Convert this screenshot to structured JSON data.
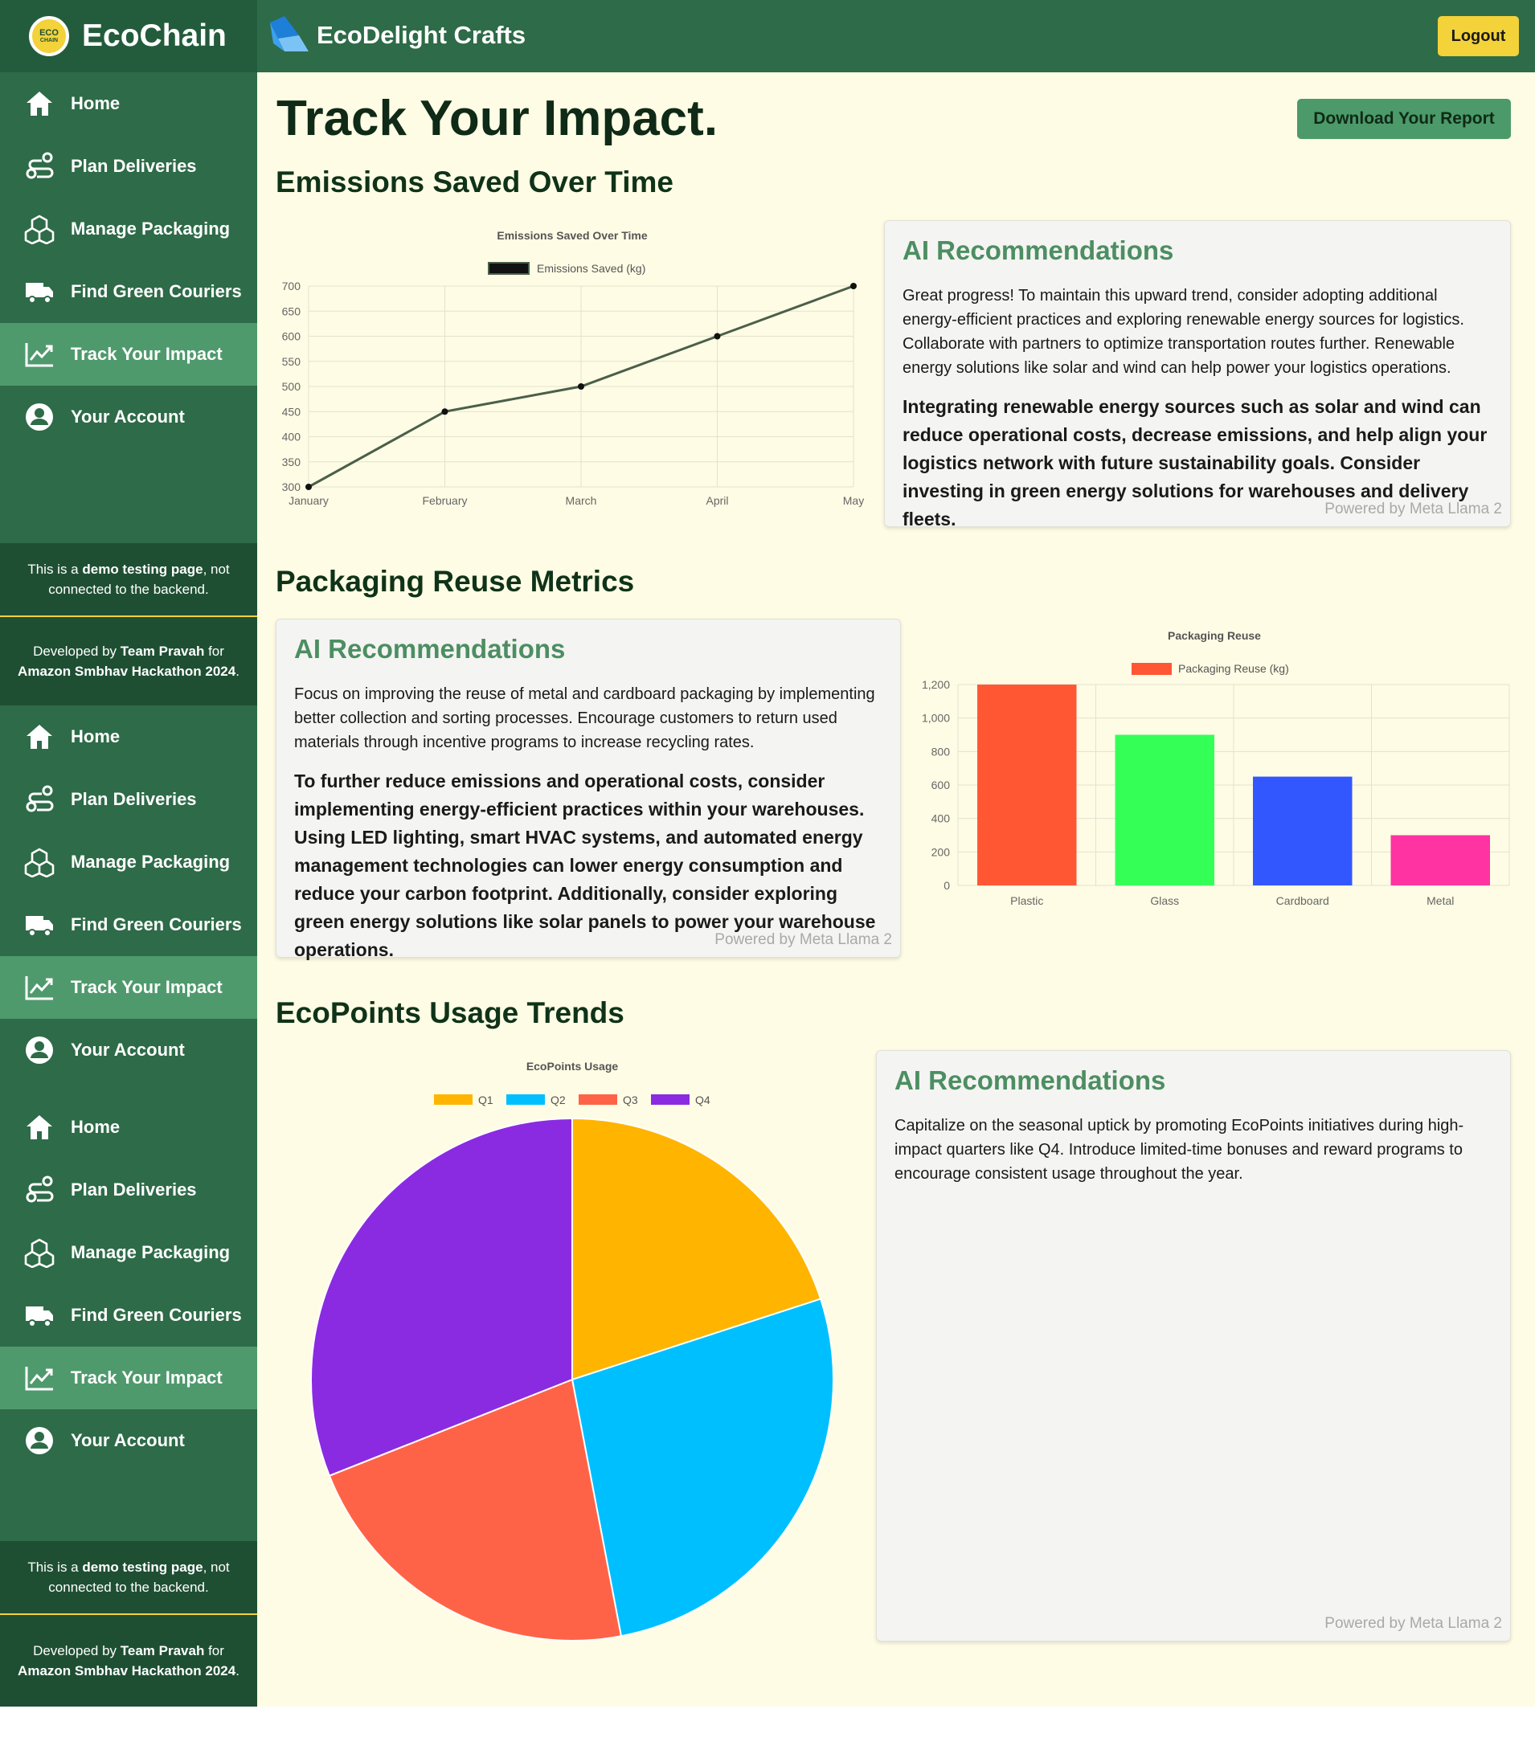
{
  "app": {
    "name": "EcoChain",
    "logo_top": "ECO",
    "logo_bottom": "CHAIN",
    "company": "EcoDelight Crafts",
    "logout": "Logout"
  },
  "nav": [
    {
      "label": "Home",
      "icon": "home-icon"
    },
    {
      "label": "Plan Deliveries",
      "icon": "route-icon"
    },
    {
      "label": "Manage Packaging",
      "icon": "boxes-icon"
    },
    {
      "label": "Find Green Couriers",
      "icon": "truck-icon"
    },
    {
      "label": "Track Your Impact",
      "icon": "chart-line-icon",
      "active": true
    },
    {
      "label": "Your Account",
      "icon": "user-circle-icon"
    }
  ],
  "sidebar_notes": {
    "demo_pre": "This is a ",
    "demo_bold": "demo testing page",
    "demo_post": ", not connected to the backend.",
    "dev_pre": "Developed by ",
    "dev_bold1": "Team Pravah",
    "dev_mid": " for ",
    "dev_bold2": "Amazon Smbhav Hackathon 2024",
    "dev_post": "."
  },
  "page": {
    "title": "Track Your Impact.",
    "download_button": "Download Your Report"
  },
  "sections": {
    "emissions": "Emissions Saved Over Time",
    "packaging": "Packaging Reuse Metrics",
    "ecopoints": "EcoPoints Usage Trends"
  },
  "ai": {
    "title": "AI Recommendations",
    "powered": "Powered by Meta Llama 2",
    "emissions_small": "Great progress! To maintain this upward trend, consider adopting additional energy-efficient practices and exploring renewable energy sources for logistics. Collaborate with partners to optimize transportation routes further. Renewable energy solutions like solar and wind can help power your logistics operations.",
    "emissions_big": "Integrating renewable energy sources such as solar and wind can reduce operational costs, decrease emissions, and help align your logistics network with future sustainability goals. Consider investing in green energy solutions for warehouses and delivery fleets.",
    "packaging_small": "Focus on improving the reuse of metal and cardboard packaging by implementing better collection and sorting processes. Encourage customers to return used materials through incentive programs to increase recycling rates.",
    "packaging_big": "To further reduce emissions and operational costs, consider implementing energy-efficient practices within your warehouses. Using LED lighting, smart HVAC systems, and automated energy management technologies can lower energy consumption and reduce your carbon footprint. Additionally, consider exploring green energy solutions like solar panels to power your warehouse operations.",
    "ecopoints_small": "Capitalize on the seasonal uptick by promoting EcoPoints initiatives during high-impact quarters like Q4. Introduce limited-time bonuses and reward programs to encourage consistent usage throughout the year."
  },
  "chart_data": [
    {
      "type": "line",
      "title": "Emissions Saved Over Time",
      "categories": [
        "January",
        "February",
        "March",
        "April",
        "May"
      ],
      "series": [
        {
          "name": "Emissions Saved (kg)",
          "values": [
            300,
            450,
            500,
            600,
            700
          ],
          "color": "#4a5f4a"
        }
      ],
      "ylim": [
        300,
        700
      ],
      "yticks": [
        300,
        350,
        400,
        450,
        500,
        550,
        600,
        650,
        700
      ],
      "grid": true,
      "legend": "top"
    },
    {
      "type": "bar",
      "title": "Packaging Reuse",
      "categories": [
        "Plastic",
        "Glass",
        "Cardboard",
        "Metal"
      ],
      "series": [
        {
          "name": "Packaging Reuse (kg)",
          "values": [
            1200,
            900,
            650,
            300
          ]
        }
      ],
      "colors": [
        "#ff5733",
        "#33ff57",
        "#3357ff",
        "#ff33a1"
      ],
      "ylim": [
        0,
        1200
      ],
      "yticks": [
        "0",
        "200",
        "400",
        "600",
        "800",
        "1,000",
        "1,200"
      ],
      "grid": true,
      "legend": "top"
    },
    {
      "type": "pie",
      "title": "EcoPoints Usage",
      "categories": [
        "Q1",
        "Q2",
        "Q3",
        "Q4"
      ],
      "values": [
        20,
        27,
        22,
        31
      ],
      "colors": [
        "#ffb400",
        "#00bfff",
        "#ff6347",
        "#8a2be2"
      ],
      "legend": "top"
    }
  ]
}
